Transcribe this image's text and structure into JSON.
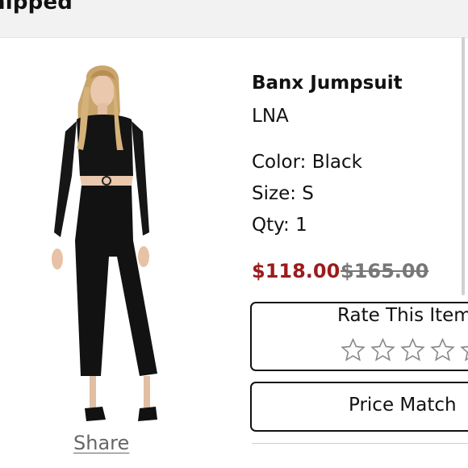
{
  "header": {
    "title": "hipped"
  },
  "product": {
    "name": "Banx Jumpsuit",
    "brand": "LNA",
    "color": "Color: Black",
    "size": "Size: S",
    "qty": "Qty: 1",
    "sale_price": "$118.00",
    "original_price": "$165.00",
    "image_icon": "model-wearing-black-jumpsuit"
  },
  "actions": {
    "share": "Share",
    "rate_title": "Rate This Item",
    "rating": {
      "value": 0,
      "max": 5
    },
    "price_match": "Price Match"
  },
  "colors": {
    "sale": "#9b1c1c",
    "original": "#777777"
  }
}
